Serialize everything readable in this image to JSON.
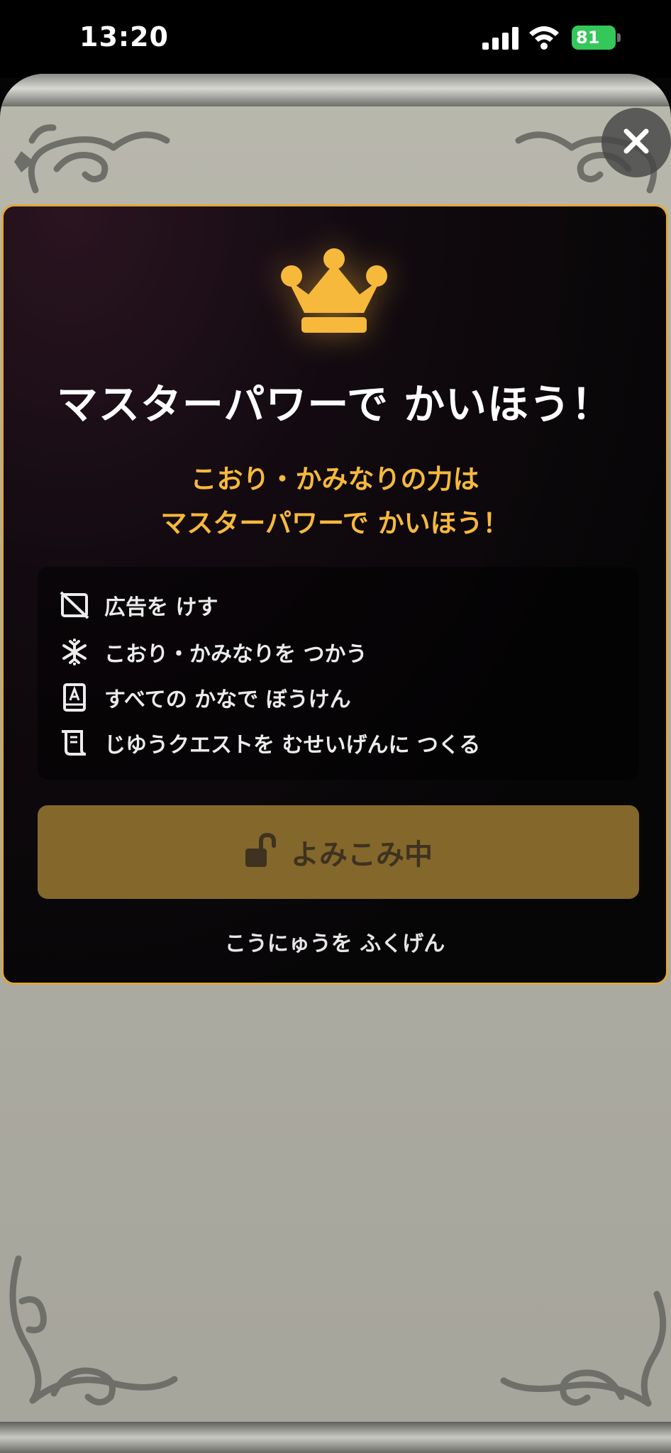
{
  "status_bar": {
    "time": "13:20",
    "battery": "81"
  },
  "modal": {
    "title": "マスターパワーで かいほう！",
    "subtitle_line1": "こおり・かみなりの力は",
    "subtitle_line2": "マスターパワーで かいほう！",
    "features": [
      {
        "icon": "no-ads-icon",
        "label": "広告を けす"
      },
      {
        "icon": "snowflake-icon",
        "label": "こおり・かみなりを つかう"
      },
      {
        "icon": "kana-book-icon",
        "label": "すべての かなで ぼうけん"
      },
      {
        "icon": "scroll-icon",
        "label": "じゆうクエストを むせいげんに つくる"
      }
    ],
    "primary_button_label": "よみこみ中",
    "restore_label": "こうにゅうを ふくげん"
  },
  "colors": {
    "accent": "#f6b93b",
    "button_disabled": "#84672a",
    "modal_border": "#e0a83a",
    "battery": "#34c759"
  }
}
